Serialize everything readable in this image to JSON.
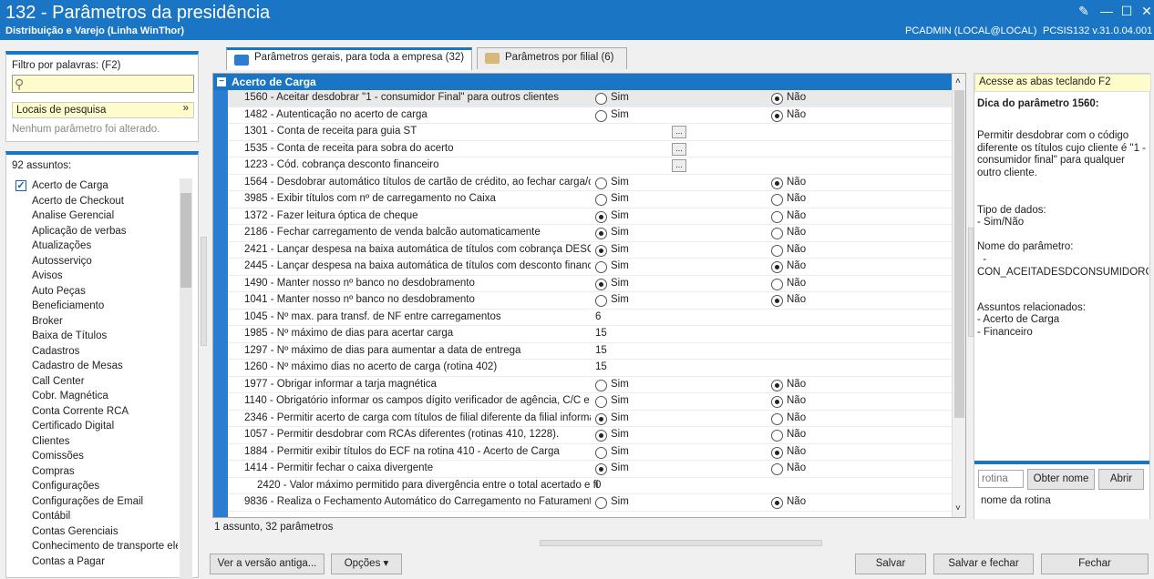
{
  "window": {
    "title": "132 - Parâmetros da presidência",
    "subtitle": "Distribuição e Varejo (Linha WinThor)",
    "user": "PCADMIN (LOCAL@LOCAL)",
    "version": "PCSIS132  v.31.0.04.001"
  },
  "filter": {
    "label": "Filtro por palavras: (F2)",
    "value": "",
    "locais": "Locais de pesquisa",
    "status": "Nenhum parâmetro foi alterado."
  },
  "subjects": {
    "count_label": "92 assuntos:",
    "items": [
      "Acerto de Carga",
      "Acerto de Checkout",
      "Analise Gerencial",
      "Aplicação de verbas",
      "Atualizações",
      "Autosserviço",
      "Avisos",
      "Auto Peças",
      "Beneficiamento",
      "Broker",
      "Baixa de Títulos",
      "Cadastros",
      "Cadastro de Mesas",
      "Call Center",
      "Cobr. Magnética",
      "Conta Corrente RCA",
      "Certificado Digital",
      "Clientes",
      "Comissões",
      "Compras",
      "Configurações",
      "Configurações de Email",
      "Contábil",
      "Contas Gerenciais",
      "Conhecimento de transporte ele",
      "Contas a Pagar"
    ]
  },
  "tabs": [
    {
      "label": "Parâmetros gerais, para toda a empresa  (32)"
    },
    {
      "label": "Parâmetros por filial  (6)"
    }
  ],
  "grid": {
    "group": "Acerto de Carga",
    "sim": "Sim",
    "nao": "Não",
    "rows": [
      {
        "name": "1560 - Aceitar desdobrar \"1 - consumidor Final\" para outros clientes",
        "type": "bool",
        "value": "nao"
      },
      {
        "name": "1482 - Autenticação no acerto de carga",
        "type": "bool",
        "value": "nao"
      },
      {
        "name": "1301 - Conta de receita para guia ST",
        "type": "lookup",
        "value": "..."
      },
      {
        "name": "1535 - Conta de receita para sobra do acerto",
        "type": "lookup",
        "value": "..."
      },
      {
        "name": "1223 - Cód. cobrança desconto financeiro",
        "type": "lookup",
        "value": "..."
      },
      {
        "name": "1564 - Desdobrar automático títulos de cartão de crédito, ao fechar carga/ca",
        "type": "bool",
        "value": "nao"
      },
      {
        "name": "3985 - Exibir títulos com nº de carregamento no Caixa",
        "type": "bool",
        "value": "none"
      },
      {
        "name": "1372 - Fazer leitura óptica de cheque",
        "type": "bool",
        "value": "sim"
      },
      {
        "name": "2186 - Fechar carregamento de venda balcão automaticamente",
        "type": "bool",
        "value": "sim"
      },
      {
        "name": "2421 - Lançar despesa na baixa automática de títulos com cobrança DESC.",
        "type": "bool",
        "value": "sim"
      },
      {
        "name": "2445 - Lançar despesa na baixa automática de títulos com desconto financeir",
        "type": "bool",
        "value": "nao"
      },
      {
        "name": "1490 - Manter nosso nº banco no desdobramento",
        "type": "bool",
        "value": "sim"
      },
      {
        "name": "1041 - Manter nosso nº banco no desdobramento",
        "type": "bool",
        "value": "nao"
      },
      {
        "name": "1045 - Nº max. para transf. de NF entre carregamentos",
        "type": "num",
        "value": "6"
      },
      {
        "name": "1985 - Nº máximo de dias para acertar carga",
        "type": "num",
        "value": "15"
      },
      {
        "name": "1297 - Nº máximo de dias para aumentar a data de entrega",
        "type": "num",
        "value": "15"
      },
      {
        "name": "1260 - Nº máximo dias no acerto de carga (rotina 402)",
        "type": "num",
        "value": "15"
      },
      {
        "name": "1977 - Obrigar informar a tarja magnética",
        "type": "bool",
        "value": "nao"
      },
      {
        "name": "1140 - Obrigatório informar os campos dígito verificador de agência, C/C e ch",
        "type": "bool",
        "value": "nao"
      },
      {
        "name": "2346 - Permitir acerto de carga com títulos de filial diferente da filial informad",
        "type": "bool",
        "value": "sim"
      },
      {
        "name": "1057 - Permitir desdobrar com RCAs diferentes (rotinas 410, 1228).",
        "type": "bool",
        "value": "sim"
      },
      {
        "name": "1884 - Permitir exibir títulos do ECF na rotina 410 - Acerto de Carga",
        "type": "bool",
        "value": "nao"
      },
      {
        "name": "1414 - Permitir fechar o caixa divergente",
        "type": "bool",
        "value": "sim"
      },
      {
        "name": "2420 - Valor máximo permitido para divergência entre o total acertado e fi",
        "type": "num",
        "value": "0"
      },
      {
        "name": "9836 - Realiza o Fechamento Automático do Carregamento no Faturamento",
        "type": "bool",
        "value": "nao"
      }
    ]
  },
  "status_bar": "1 assunto, 32 parâmetros",
  "help": {
    "tip": "Acesse as abas teclando F2",
    "title": "Dica do parâmetro 1560:",
    "desc": "Permitir desdobrar com o código diferente os títulos cujo cliente é \"1 - consumidor final\" para qualquer outro cliente.",
    "type_label": "Tipo de dados:",
    "type_value": "  - Sim/Não",
    "name_label": "Nome do parâmetro:",
    "name_value": "  -\nCON_ACEITADESDCONSUMIDOROUT",
    "rel_label": "Assuntos relacionados:",
    "rel_items": "  - Acerto de Carga\n  - Financeiro",
    "rotina_placeholder": "rotina",
    "obter": "Obter nome",
    "abrir": "Abrir",
    "rotina_name": "nome da rotina"
  },
  "buttons": {
    "old": "Ver a versão antiga...",
    "opcoes": "Opções",
    "salvar": "Salvar",
    "salvar_fechar": "Salvar e fechar",
    "fechar": "Fechar"
  }
}
